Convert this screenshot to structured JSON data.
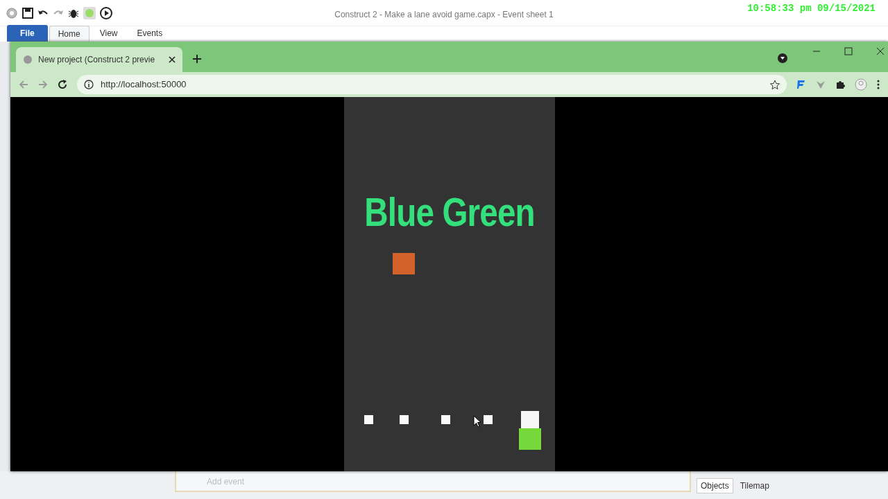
{
  "editor": {
    "title": "Construct 2 - Make a lane avoid game.capx - Event sheet 1",
    "ribbon_tabs": [
      {
        "label": "File",
        "kind": "file",
        "selected": false
      },
      {
        "label": "Home",
        "kind": "tab",
        "selected": true
      },
      {
        "label": "View",
        "kind": "tab",
        "selected": false
      },
      {
        "label": "Events",
        "kind": "tab",
        "selected": false
      }
    ],
    "add_event": "Add event",
    "panel_tabs": [
      {
        "label": "Objects",
        "selected": true
      },
      {
        "label": "Tilemap",
        "selected": false
      }
    ]
  },
  "overlay_clock": "10:58:33 pm 09/15/2021",
  "browser": {
    "tab_title": "New project (Construct 2 previe",
    "url": "http://localhost:50000"
  },
  "game": {
    "heading": "Blue Green"
  }
}
